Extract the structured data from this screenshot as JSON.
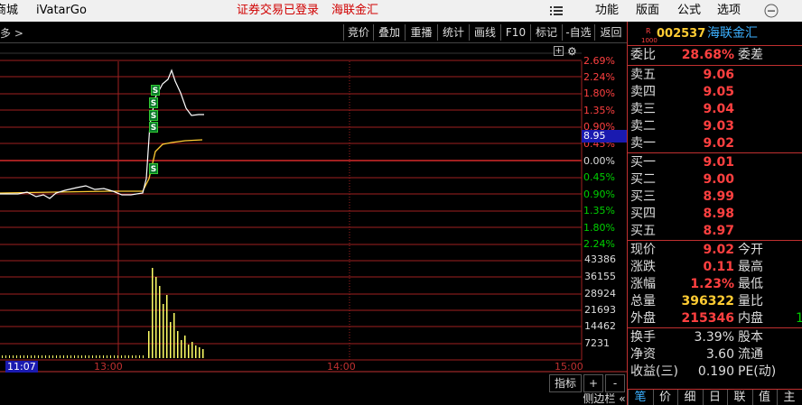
{
  "topbar": {
    "left_partial": "商城",
    "app_name": "iVatarGo",
    "trade_status": "证券交易已登录",
    "stock_name": "海联金汇",
    "menu": [
      "功能",
      "版面",
      "公式",
      "选项"
    ]
  },
  "toolbar": {
    "crumb": "多 >",
    "buttons": [
      "竞价",
      "叠加",
      "重播",
      "统计",
      "画线",
      "F10",
      "标记",
      "-自选",
      "返回"
    ]
  },
  "chart": {
    "pct_labels_up": [
      "2.69%",
      "2.24%",
      "1.80%",
      "1.35%",
      "0.90%",
      "0.45%"
    ],
    "pct_zero": "0.00%",
    "pct_labels_down": [
      "0.45%",
      "0.90%",
      "1.35%",
      "1.80%",
      "2.24%"
    ],
    "current_price_box": "8.95",
    "volume_labels": [
      "43386",
      "36155",
      "28924",
      "21693",
      "14462",
      "7231"
    ],
    "time_labels": [
      "11:07",
      "13:00",
      "14:00",
      "15:00"
    ],
    "signal_marker": "S",
    "bottom_buttons": [
      "指标",
      "+",
      "-"
    ],
    "side_toggle": "侧边栏 «",
    "colors": {
      "price_line": "#ffffff",
      "avg_line": "#ffcc33",
      "grid": "#a02020",
      "up": "#ff4040",
      "down": "#00d000",
      "volume": "#ffff66"
    }
  },
  "quote": {
    "code_prefix": "R",
    "code_sub": "1000",
    "code": "002537",
    "name": "海联金汇",
    "weibi_label": "委比",
    "weibi_value": "28.68%",
    "weicha_label": "委差",
    "asks": [
      {
        "label": "卖五",
        "price": "9.06"
      },
      {
        "label": "卖四",
        "price": "9.05"
      },
      {
        "label": "卖三",
        "price": "9.04"
      },
      {
        "label": "卖二",
        "price": "9.03"
      },
      {
        "label": "卖一",
        "price": "9.02"
      }
    ],
    "bids": [
      {
        "label": "买一",
        "price": "9.01"
      },
      {
        "label": "买二",
        "price": "9.00"
      },
      {
        "label": "买三",
        "price": "8.99"
      },
      {
        "label": "买四",
        "price": "8.98"
      },
      {
        "label": "买五",
        "price": "8.97"
      }
    ],
    "stats": [
      {
        "label": "现价",
        "value": "9.02",
        "label2": "今开"
      },
      {
        "label": "涨跌",
        "value": "0.11",
        "label2": "最高"
      },
      {
        "label": "涨幅",
        "value": "1.23%",
        "label2": "最低"
      },
      {
        "label": "总量",
        "value": "396322",
        "label2": "量比"
      },
      {
        "label": "外盘",
        "value": "215346",
        "label2": "内盘",
        "extra": "1"
      }
    ],
    "stats2": [
      {
        "label": "换手",
        "value": "3.39%",
        "label2": "股本"
      },
      {
        "label": "净资",
        "value": "3.60",
        "label2": "流通"
      },
      {
        "label": "收益(三)",
        "value": "0.190",
        "label2": "PE(动)"
      }
    ],
    "tabs": [
      "笔",
      "价",
      "细",
      "日",
      "联",
      "值",
      "主"
    ]
  }
}
